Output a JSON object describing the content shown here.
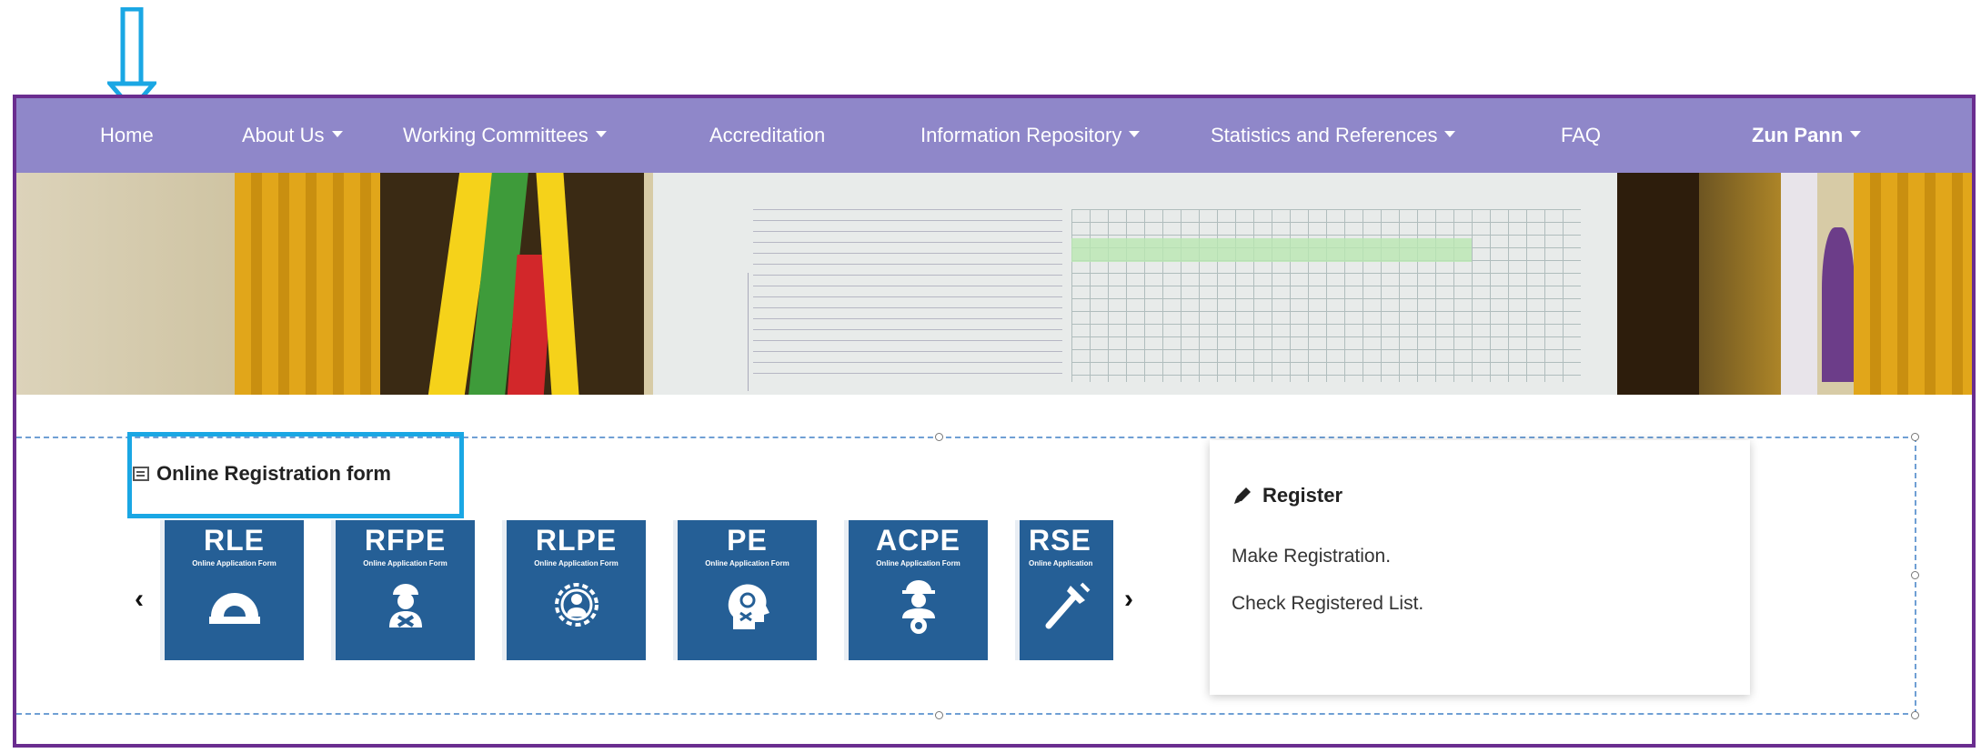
{
  "nav": {
    "home": "Home",
    "about": "About Us",
    "committees": "Working Committees",
    "accreditation": "Accreditation",
    "repository": "Information Repository",
    "statistics": "Statistics and References",
    "faq": "FAQ",
    "user": "Zun Pann"
  },
  "registration": {
    "title": "Online Registration form",
    "cards": [
      {
        "abbr": "RLE",
        "sub": "Online Application Form",
        "icon": "protractor-icon"
      },
      {
        "abbr": "RFPE",
        "sub": "Online Application Form",
        "icon": "engineer-tools-icon"
      },
      {
        "abbr": "RLPE",
        "sub": "Online Application Form",
        "icon": "gear-person-icon"
      },
      {
        "abbr": "PE",
        "sub": "Online Application Form",
        "icon": "head-gears-icon"
      },
      {
        "abbr": "ACPE",
        "sub": "Online Application Form",
        "icon": "hardhat-worker-icon"
      },
      {
        "abbr": "RSE",
        "sub": "Online Application",
        "icon": "wrench-screwdriver-icon"
      }
    ],
    "prev": "‹",
    "next": "›"
  },
  "register_panel": {
    "title": "Register",
    "make": "Make Registration.",
    "check": "Check Registered List."
  },
  "colors": {
    "navbar": "#8f87c9",
    "card": "#255f96",
    "frame": "#6a2d8f",
    "highlight": "#1aa7e4"
  }
}
